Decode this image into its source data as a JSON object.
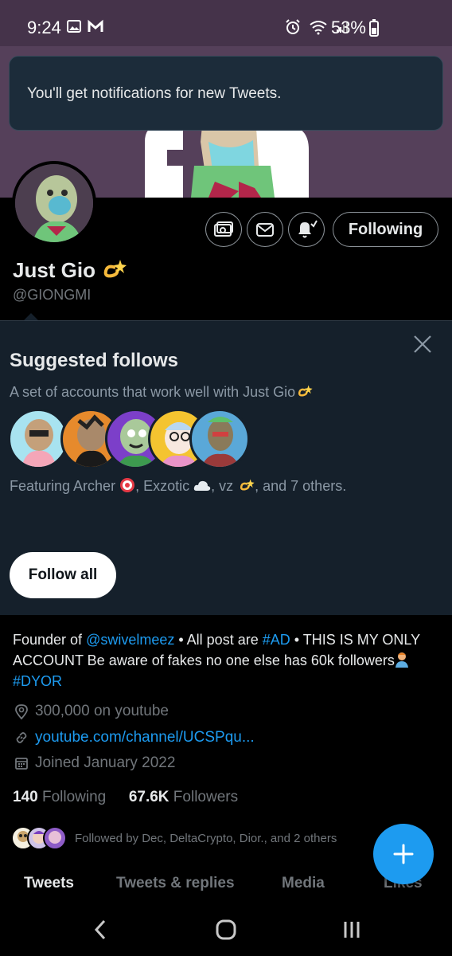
{
  "status_bar": {
    "time": "9:24",
    "battery": "53%"
  },
  "toast": {
    "message": "You'll get notifications for new Tweets."
  },
  "profile": {
    "display_name": "Just Gio",
    "handle": "@GIONGMI",
    "follow_button": "Following"
  },
  "suggested": {
    "title": "Suggested follows",
    "subtitle": "A set of accounts that work well with Just Gio",
    "featuring_prefix": "Featuring Archer ",
    "featuring_mid1": ", Exzotic ",
    "featuring_mid2": ", vz ",
    "featuring_suffix": ", and 7 others.",
    "follow_all": "Follow all"
  },
  "bio": {
    "text1": "Founder of ",
    "mention": "@swivelmeez",
    "text2": " • All post are ",
    "hashtag1": "#AD",
    "text3": " • THIS IS MY ONLY ACCOUNT Be aware of fakes no one else has 60k followers",
    "hashtag2": "#DYOR"
  },
  "meta": {
    "location": "300,000 on youtube",
    "website": "youtube.com/channel/UCSPqu...",
    "joined": "Joined January 2022"
  },
  "counts": {
    "following_count": "140",
    "following_label": "Following",
    "followers_count": "67.6K",
    "followers_label": "Followers"
  },
  "followed_by": "Followed by Dec, DeltaCrypto, Dior., and 2 others",
  "tabs": [
    "Tweets",
    "Tweets & replies",
    "Media",
    "Likes"
  ],
  "colors": {
    "accent": "#1d9bf0",
    "background": "#000000",
    "card": "#15202b",
    "status_bar": "#45334a"
  }
}
